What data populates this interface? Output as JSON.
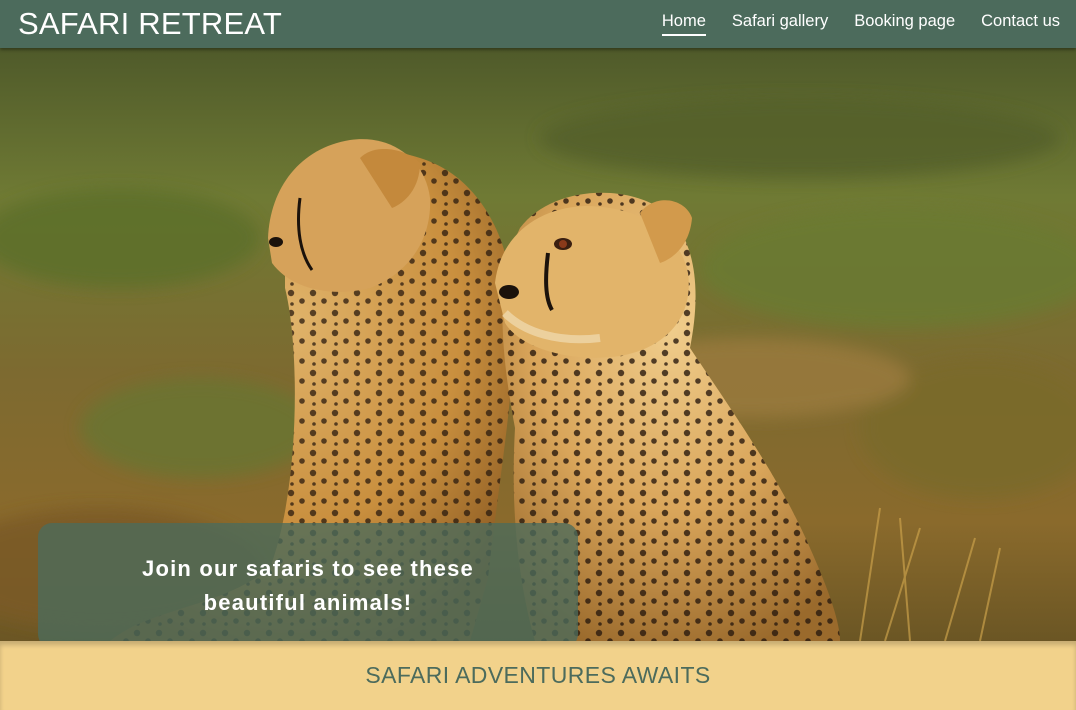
{
  "header": {
    "title": "SAFARI RETREAT",
    "nav": [
      {
        "label": "Home",
        "active": true
      },
      {
        "label": "Safari gallery",
        "active": false
      },
      {
        "label": "Booking page",
        "active": false
      },
      {
        "label": "Contact us",
        "active": false
      }
    ]
  },
  "hero": {
    "caption": "Join our safaris to see these beautiful animals!"
  },
  "band": {
    "heading": "SAFARI ADVENTURES AWAITS"
  },
  "colors": {
    "nav_bg": "#4c6b5c",
    "band_bg": "#f2d28b",
    "heading": "#4c6b5c"
  }
}
